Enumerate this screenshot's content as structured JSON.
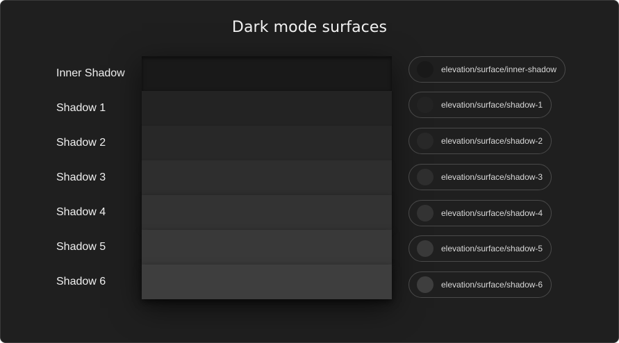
{
  "title": "Dark mode surfaces",
  "rows": [
    {
      "label": "Inner Shadow",
      "token": "elevation/surface/inner-shadow",
      "color": "#191919"
    },
    {
      "label": "Shadow 1",
      "token": "elevation/surface/shadow-1",
      "color": "#232323"
    },
    {
      "label": "Shadow 2",
      "token": "elevation/surface/shadow-2",
      "color": "#282828"
    },
    {
      "label": "Shadow 3",
      "token": "elevation/surface/shadow-3",
      "color": "#2e2e2e"
    },
    {
      "label": "Shadow 4",
      "token": "elevation/surface/shadow-4",
      "color": "#333333"
    },
    {
      "label": "Shadow 5",
      "token": "elevation/surface/shadow-5",
      "color": "#393939"
    },
    {
      "label": "Shadow 6",
      "token": "elevation/surface/shadow-6",
      "color": "#3e3e3e"
    }
  ]
}
